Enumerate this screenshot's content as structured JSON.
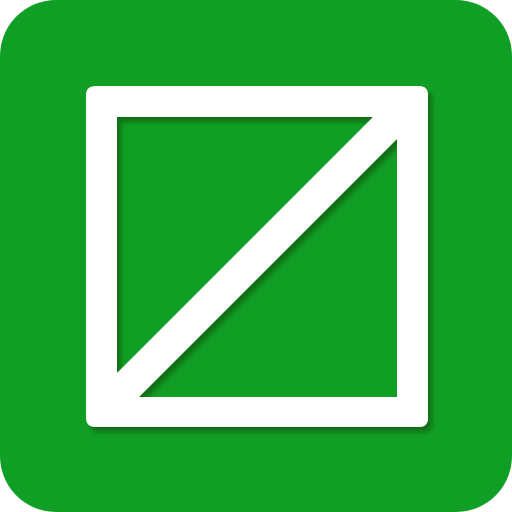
{
  "icon": {
    "name": "square-with-diagonal-icon",
    "background_color": "#119e24",
    "foreground_color": "#ffffff",
    "shadow_color": "#0a5f16"
  }
}
